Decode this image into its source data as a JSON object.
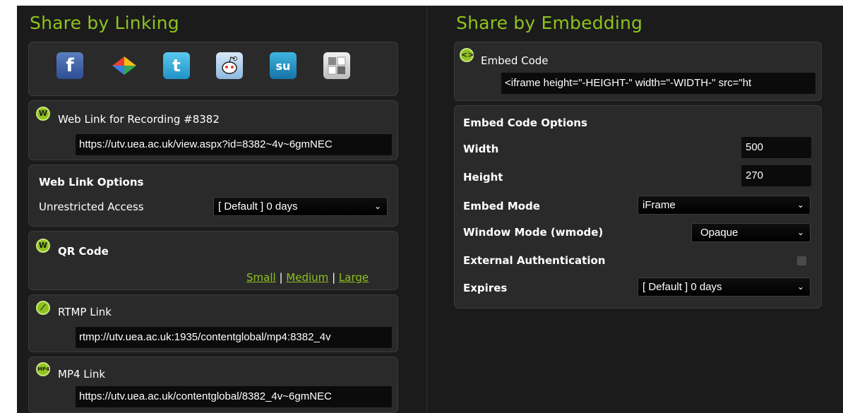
{
  "left": {
    "title": "Share by Linking",
    "share_icons": [
      "facebook-icon",
      "google-buzz-icon",
      "twitter-icon",
      "reddit-icon",
      "stumbleupon-icon",
      "delicious-icon"
    ],
    "web_link": {
      "label": "Web Link for Recording #8382",
      "value": "https://utv.uea.ac.uk/view.aspx?id=8382~4v~6gmNEC"
    },
    "web_link_options": {
      "title": "Web Link Options",
      "access_label": "Unrestricted Access",
      "access_value": "[ Default ] 0 days"
    },
    "qr": {
      "label": "QR Code",
      "small": "Small",
      "medium": "Medium",
      "large": "Large",
      "sep": "|"
    },
    "rtmp": {
      "label": "RTMP Link",
      "value": "rtmp://utv.uea.ac.uk:1935/contentglobal/mp4:8382_4v"
    },
    "mp4": {
      "label": "MP4 Link",
      "value": "https://utv.uea.ac.uk/contentglobal/8382_4v~6gmNEC"
    }
  },
  "right": {
    "title": "Share by Embedding",
    "embed_code": {
      "label": "Embed Code",
      "value": "<iframe height=\"-HEIGHT-\" width=\"-WIDTH-\" src=\"ht"
    },
    "options": {
      "title": "Embed Code Options",
      "width_label": "Width",
      "width_value": "500",
      "height_label": "Height",
      "height_value": "270",
      "mode_label": "Embed Mode",
      "mode_value": "iFrame",
      "wmode_label": "Window Mode (wmode)",
      "wmode_value": "Opaque",
      "auth_label": "External Authentication",
      "expires_label": "Expires",
      "expires_value": "[ Default ] 0 days"
    }
  },
  "colors": {
    "accent": "#8fc21f",
    "background": "#1b1b1b",
    "panel": "#2a2a2a"
  }
}
